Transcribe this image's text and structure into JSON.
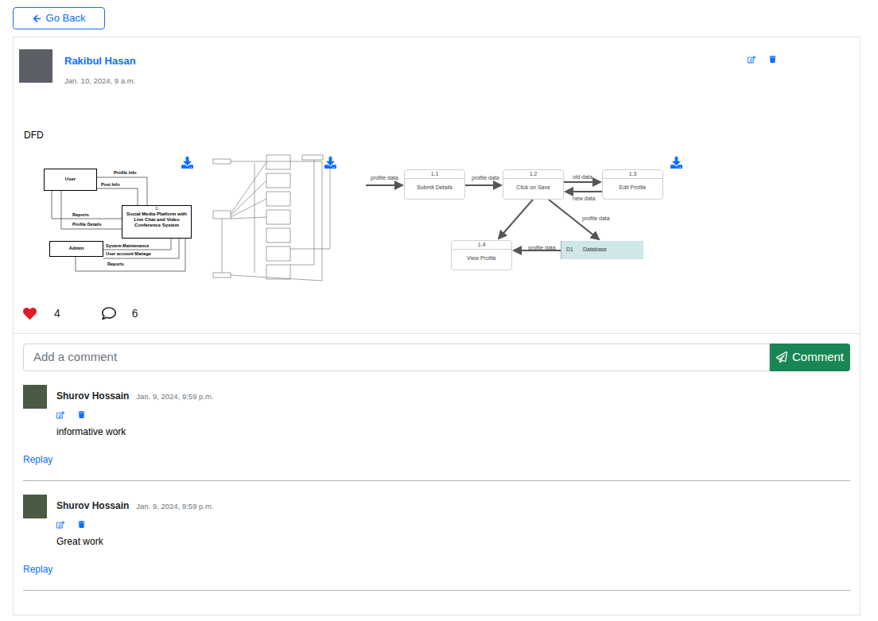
{
  "back_button": {
    "label": "Go Back"
  },
  "post": {
    "author": "Rakibul Hasan",
    "time": "Jan. 10, 2024, 9 a.m.",
    "text": "DFD",
    "liked": true,
    "likes": "4",
    "comments_count": "6",
    "attachments": [
      {
        "kind": "context-diagram",
        "entities": [
          "User",
          "Admin"
        ],
        "process": {
          "number": "0",
          "title": "Social Media Platform with Live Chat and Video Conference System"
        },
        "flows": [
          "Profile Info",
          "Post Info",
          "Reports",
          "Profile Details",
          "System Maintenance",
          "User account Manage",
          "Reports"
        ]
      },
      {
        "kind": "plain"
      },
      {
        "kind": "process-diagram",
        "processes": [
          {
            "number": "1.1",
            "title": "Submit Details"
          },
          {
            "number": "1.2",
            "title": "Click on Save"
          },
          {
            "number": "1.3",
            "title": "Edit Profile"
          },
          {
            "number": "1.4",
            "title": "View Profile"
          }
        ],
        "store": {
          "id": "D1",
          "title": "Database"
        },
        "flows": [
          "profile data",
          "profile data",
          "old data",
          "new data",
          "profile data",
          "profile data"
        ]
      }
    ]
  },
  "comment_box": {
    "placeholder": "Add a comment",
    "button": "Comment"
  },
  "comments": [
    {
      "author": "Shurov Hossain",
      "time": "Jan. 9, 2024, 9:59 p.m.",
      "text": "informative work",
      "reply": "Replay"
    },
    {
      "author": "Shurov Hossain",
      "time": "Jan. 9, 2024, 9:59 p.m.",
      "text": "Great work",
      "reply": "Replay"
    }
  ]
}
